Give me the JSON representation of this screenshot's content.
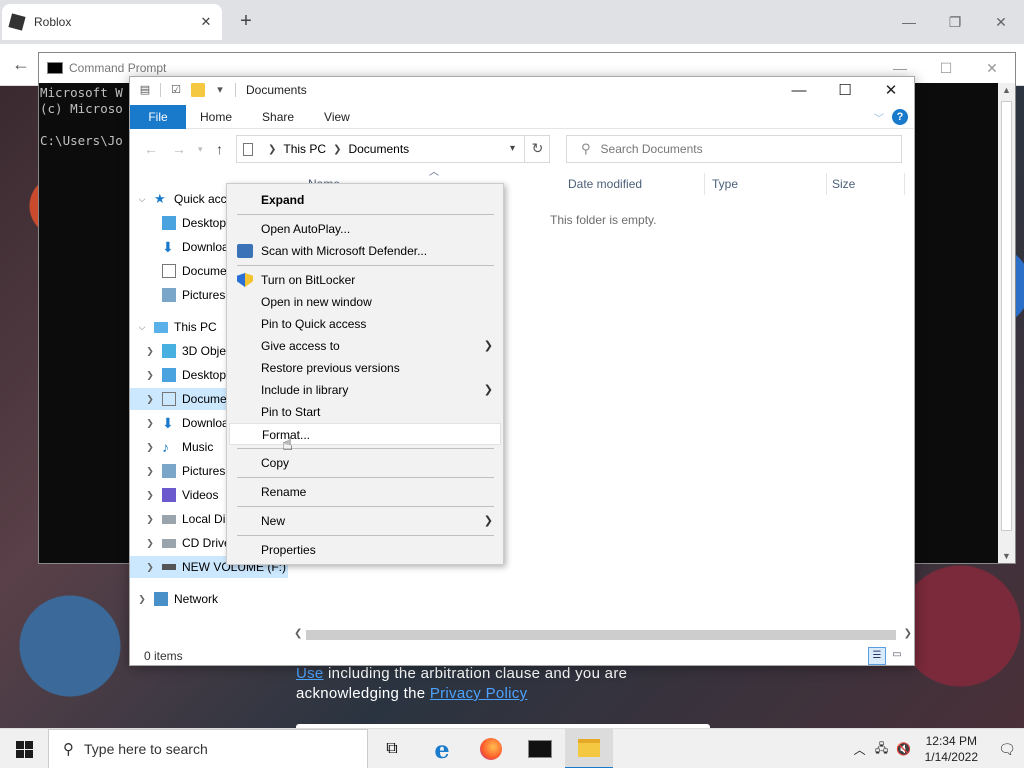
{
  "browser": {
    "tab_title": "Roblox",
    "tab_close": "✕",
    "new_tab": "+",
    "minimize": "—",
    "restore": "❐",
    "close": "✕",
    "back": "←"
  },
  "webpage": {
    "legal_link1": "Use",
    "legal_mid": " including the arbitration clause and you are acknowledging the ",
    "legal_link2": "Privacy Policy"
  },
  "cmd": {
    "title": "Command Prompt",
    "line1": "Microsoft W",
    "line2": "(c) Microso",
    "line3": "",
    "line4": "C:\\Users\\Jo",
    "minimize": "—",
    "maximize": "☐",
    "close": "✕"
  },
  "explorer": {
    "title": "Documents",
    "minimize": "—",
    "maximize": "☐",
    "close": "✕",
    "ribbon": {
      "file": "File",
      "home": "Home",
      "share": "Share",
      "view": "View",
      "help": "?"
    },
    "address": {
      "this_pc": "This PC",
      "documents": "Documents"
    },
    "search_placeholder": "Search Documents",
    "columns": {
      "name": "Name",
      "date_modified": "Date modified",
      "type": "Type",
      "size": "Size"
    },
    "empty_message": "This folder is empty.",
    "status_count": "0 items",
    "nav": {
      "quick_access": "Quick acc",
      "qa_desktop": "Desktop",
      "qa_downloads": "Downloa",
      "qa_documents": "Docume",
      "qa_pictures": "Pictures",
      "this_pc": "This PC",
      "objects3d": "3D Obje",
      "desktop": "Desktop",
      "documents": "Docume",
      "downloads": "Downloa",
      "music": "Music",
      "pictures": "Pictures",
      "videos": "Videos",
      "local_disk": "Local Di",
      "cd_drive": "CD Drive",
      "new_volume": "NEW VOLUME (F:)",
      "network": "Network"
    }
  },
  "context_menu": {
    "expand": "Expand",
    "open_autoplay": "Open AutoPlay...",
    "scan_defender": "Scan with Microsoft Defender...",
    "turn_on_bitlocker": "Turn on BitLocker",
    "open_new_window": "Open in new window",
    "pin_quick_access": "Pin to Quick access",
    "give_access": "Give access to",
    "restore_versions": "Restore previous versions",
    "include_library": "Include in library",
    "pin_start": "Pin to Start",
    "format": "Format...",
    "copy": "Copy",
    "rename": "Rename",
    "new": "New",
    "properties": "Properties"
  },
  "taskbar": {
    "search_placeholder": "Type here to search",
    "time": "12:34 PM",
    "date": "1/14/2022"
  },
  "icons": {
    "search": "search-icon",
    "refresh": "refresh-icon",
    "shield": "shield-icon",
    "hand_cursor": "hand-cursor-icon"
  }
}
